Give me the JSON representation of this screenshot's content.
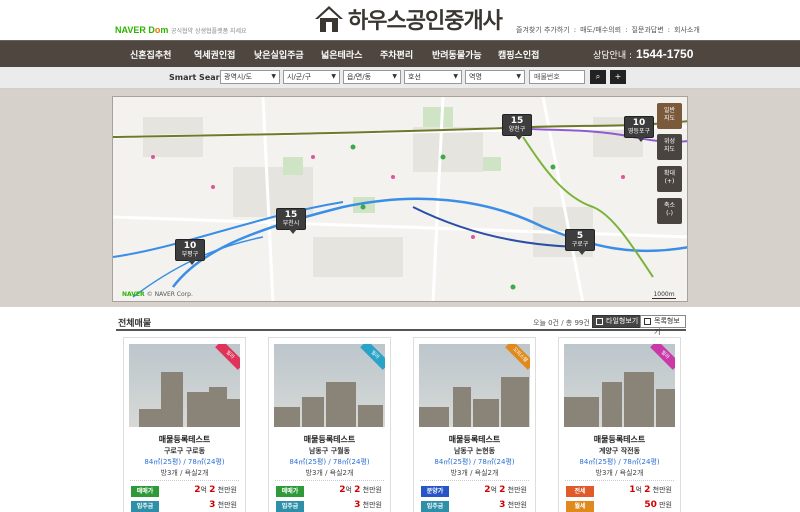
{
  "header": {
    "naver_logo_a": "NAVER",
    "naver_logo_b": " D",
    "naver_logo_c": "o",
    "naver_logo_d": "m",
    "partner_text": "공식협약 상생협플랫폼 지세요",
    "site_name": "하우스공인중개사",
    "links": [
      "즐겨찾기 추가하기",
      ":",
      "매도/매수의뢰",
      ":",
      "질문과답변",
      ":",
      "회사소개"
    ]
  },
  "nav": {
    "items": [
      "신혼집추천",
      "역세권인접",
      "낮은실입주금",
      "넓은테라스",
      "주차편리",
      "반려동물가능",
      "캠핑스인접"
    ],
    "phone_label": "상담안내 :",
    "phone_number": "1544-1750"
  },
  "search": {
    "label": "Smart Search",
    "selects": [
      "광역시/도",
      "시/군/구",
      "읍/면/동",
      "호선",
      "역명"
    ],
    "input_placeholder": "매물번호",
    "search_icon": "search-icon",
    "plus_icon": "plus-icon"
  },
  "map": {
    "markers": [
      {
        "count": "15",
        "label": "양천구"
      },
      {
        "count": "10",
        "label": "영등포구"
      },
      {
        "count": "15",
        "label": "부천시"
      },
      {
        "count": "5",
        "label": "구로구"
      },
      {
        "count": "10",
        "label": "부평구"
      }
    ],
    "controls": [
      {
        "line1": "일반",
        "line2": "지도"
      },
      {
        "line1": "위성",
        "line2": "지도"
      },
      {
        "line1": "확대",
        "line2": "(+)"
      },
      {
        "line1": "축소",
        "line2": "(-)"
      }
    ],
    "naver_label": "NAVER",
    "copyright": "© NAVER Corp.",
    "scale": "1000m",
    "colors": {
      "line1": "#3a8ee6",
      "line2": "#7ab33a",
      "line7": "#6c7a2a",
      "purple": "#8e5bd1",
      "blue2": "#2a4fa6"
    }
  },
  "listing": {
    "title": "전체매물",
    "count_text": "오늘 0건 / 총 99건",
    "count_today": "0",
    "btn_tile": "타일형보기",
    "btn_list": "목록형보기"
  },
  "cards": [
    {
      "ribbon": "빌라",
      "ribbon_color": "#e0335a",
      "title": "매물등록테스트",
      "addr": "구로구 구로동",
      "area": "84㎡(25평) / 78㎡(24평)",
      "rooms": "방3개 / 욕실2개",
      "rows": [
        {
          "tag": "매매가",
          "tag_color": "#2e9a3a",
          "big": "2",
          "unit1": "억",
          "small": "2",
          "unit2": "천만원"
        },
        {
          "tag": "입주금",
          "tag_color": "#2e8fa8",
          "big": "",
          "unit1": "",
          "small": "3",
          "unit2": "천만원"
        }
      ]
    },
    {
      "ribbon": "빌라",
      "ribbon_color": "#2aa3c9",
      "title": "매물등록테스트",
      "addr": "남동구 구월동",
      "area": "84㎡(25평) / 78㎡(24평)",
      "rooms": "방3개 / 욕실2개",
      "rows": [
        {
          "tag": "매매가",
          "tag_color": "#2e9a3a",
          "big": "2",
          "unit1": "억",
          "small": "2",
          "unit2": "천만원"
        },
        {
          "tag": "입주금",
          "tag_color": "#2e8fa8",
          "big": "",
          "unit1": "",
          "small": "3",
          "unit2": "천만원"
        }
      ]
    },
    {
      "ribbon": "오피스텔",
      "ribbon_color": "#e08a1e",
      "title": "매물등록테스트",
      "addr": "남동구 논현동",
      "area": "84㎡(25평) / 78㎡(24평)",
      "rooms": "방3개 / 욕실2개",
      "rows": [
        {
          "tag": "분양가",
          "tag_color": "#2756c7",
          "big": "2",
          "unit1": "억",
          "small": "2",
          "unit2": "천만원"
        },
        {
          "tag": "입주금",
          "tag_color": "#2e8fa8",
          "big": "",
          "unit1": "",
          "small": "3",
          "unit2": "천만원"
        }
      ]
    },
    {
      "ribbon": "빌라",
      "ribbon_color": "#c93aa8",
      "title": "매물등록테스트",
      "addr": "계양구 작전동",
      "area": "84㎡(25평) / 78㎡(24평)",
      "rooms": "방3개 / 욕실2개",
      "rows": [
        {
          "tag": "전세",
          "tag_color": "#e05a2a",
          "big": "1",
          "unit1": "억",
          "small": "2",
          "unit2": "천만원"
        },
        {
          "tag": "월세",
          "tag_color": "#e08a1e",
          "big": "",
          "unit1": "",
          "small": "50",
          "unit2": "만원"
        }
      ]
    }
  ]
}
